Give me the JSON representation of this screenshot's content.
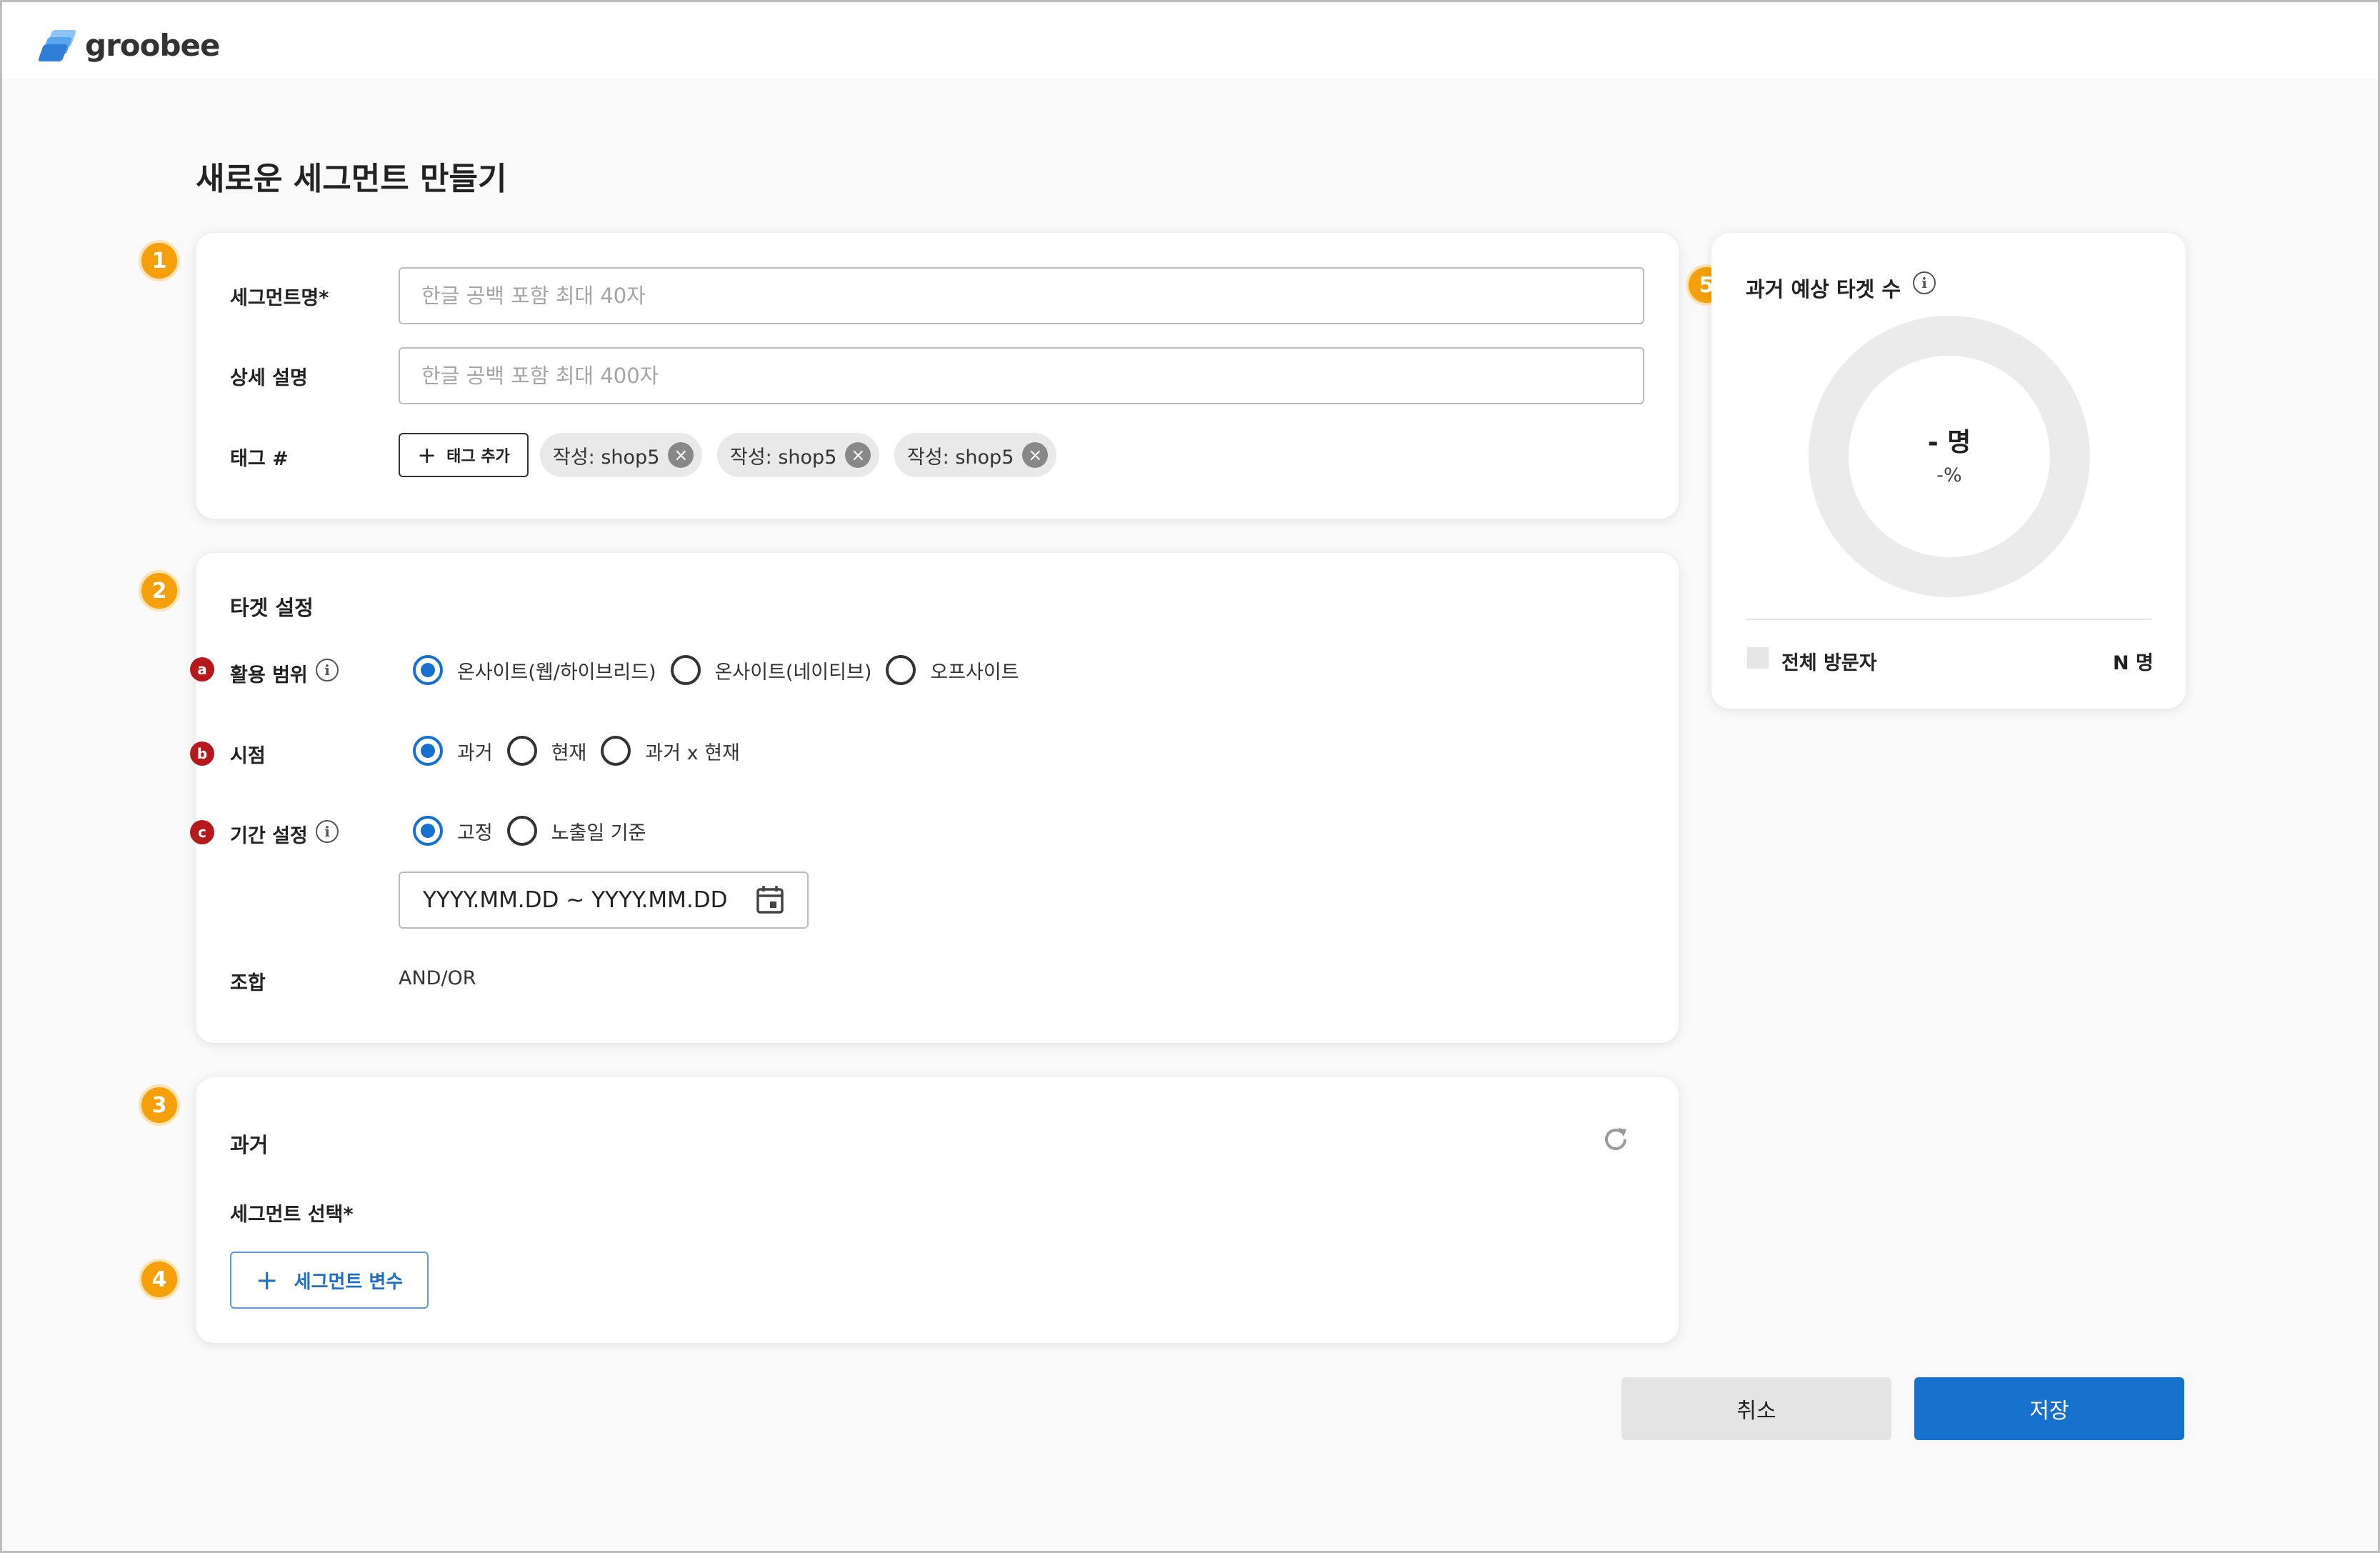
{
  "app": {
    "logo_text": "groobee"
  },
  "page": {
    "title": "새로운 세그먼트 만들기"
  },
  "steps": [
    "1",
    "2",
    "3",
    "4",
    "5"
  ],
  "basic": {
    "name_label": "세그먼트명*",
    "name_placeholder": "한글 공백 포함 최대 40자",
    "desc_label": "상세 설명",
    "desc_placeholder": "한글 공백 포함 최대 400자",
    "tag_label": "태그 #",
    "tag_add_label": "태그 추가",
    "tags": [
      "작성: shop5",
      "작성: shop5",
      "작성: shop5"
    ]
  },
  "target": {
    "title": "타겟 설정",
    "scope": {
      "badge": "a",
      "label": "활용 범위",
      "options": [
        "온사이트(웹/하이브리드)",
        "온사이트(네이티브)",
        "오프사이트"
      ],
      "selected": 0
    },
    "timepoint": {
      "badge": "b",
      "label": "시점",
      "options": [
        "과거",
        "현재",
        "과거 x 현재"
      ],
      "selected": 0
    },
    "period": {
      "badge": "c",
      "label": "기간 설정",
      "options": [
        "고정",
        "노출일 기준"
      ],
      "selected": 0,
      "date_range": "YYYY.MM.DD ~ YYYY.MM.DD"
    },
    "combo": {
      "label": "조합",
      "value": "AND/OR"
    }
  },
  "past": {
    "title": "과거",
    "segment_select_label": "세그먼트 선택*",
    "segment_var_button": "세그먼트 변수"
  },
  "estimate": {
    "title": "과거 예상 타겟 수",
    "count_text": "- 명",
    "percent_text": "-%",
    "legend_label": "전체 방문자",
    "legend_value": "N 명"
  },
  "actions": {
    "cancel": "취소",
    "save": "저장"
  },
  "colors": {
    "accent": "#1671cc",
    "step": "#f5a00a",
    "badge": "#b5191c"
  },
  "icons": [
    "info-icon",
    "calendar-icon",
    "refresh-icon",
    "close-icon",
    "plus-icon"
  ]
}
